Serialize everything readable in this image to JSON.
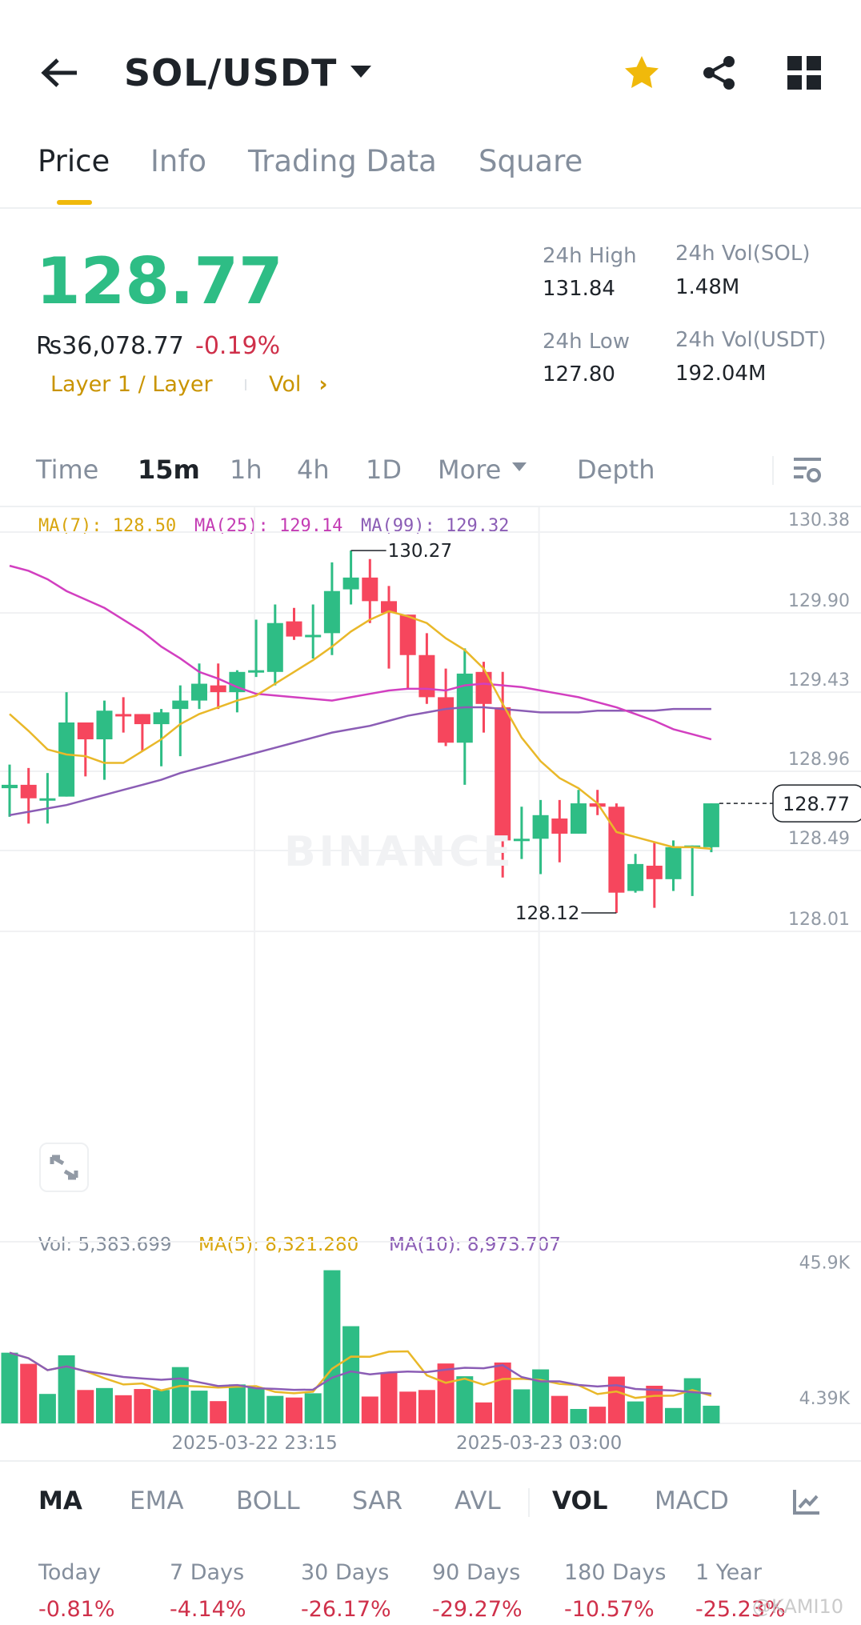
{
  "header": {
    "title": "SOL/USDT",
    "icons": [
      "back-arrow-icon",
      "caret-down-icon",
      "star-icon",
      "share-icon",
      "grid-icon"
    ]
  },
  "tabs": [
    {
      "label": "Price"
    },
    {
      "label": "Info"
    },
    {
      "label": "Trading Data"
    },
    {
      "label": "Square"
    }
  ],
  "ticker": {
    "last_price": "128.77",
    "fiat_price": "₨36,078.77",
    "change": "-0.19%",
    "tag": "Layer 1 / Layer",
    "vol_link": "Vol",
    "stats": {
      "high_label": "24h High",
      "high": "131.84",
      "low_label": "24h Low",
      "low": "127.80",
      "vol_sol_label": "24h Vol(SOL)",
      "vol_sol": "1.48M",
      "vol_usdt_label": "24h Vol(USDT)",
      "vol_usdt": "192.04M"
    }
  },
  "intervals": [
    {
      "label": "Time"
    },
    {
      "label": "15m"
    },
    {
      "label": "1h"
    },
    {
      "label": "4h"
    },
    {
      "label": "1D"
    },
    {
      "label": "More"
    },
    {
      "label": "Depth"
    }
  ],
  "legend": {
    "ma7": "MA(7): 128.50",
    "ma25": "MA(25): 129.14",
    "ma99": "MA(99): 129.32",
    "vol": "Vol: 5,383.699",
    "vma5": "MA(5): 8,321.280",
    "vma10": "MA(10): 8,973.707"
  },
  "colors": {
    "up": "#2EBD85",
    "down": "#F6465D",
    "ma7": "#E9B829",
    "ma25": "#D23FC0",
    "ma99": "#8B5DB5",
    "accent": "#F0B90B"
  },
  "chart_data": {
    "type": "candlestick",
    "interval": "15m",
    "price_ticks": [
      "130.38",
      "129.90",
      "129.43",
      "128.96",
      "128.49",
      "128.01"
    ],
    "price_range": [
      128.01,
      130.38
    ],
    "last_price_tag": "128.77",
    "high_marker": "130.27",
    "low_marker": "128.12",
    "x_ticks": [
      "2025-03-22 23:15",
      "2025-03-23 03:00"
    ],
    "x_tick_index": [
      13,
      28
    ],
    "ohlc": [
      [
        128.86,
        129.0,
        128.69,
        128.88
      ],
      [
        128.88,
        128.98,
        128.65,
        128.8
      ],
      [
        128.79,
        128.95,
        128.65,
        128.8
      ],
      [
        128.81,
        129.43,
        128.81,
        129.25
      ],
      [
        129.25,
        129.25,
        128.93,
        129.15
      ],
      [
        129.15,
        129.38,
        128.91,
        129.32
      ],
      [
        129.3,
        129.4,
        129.19,
        129.29
      ],
      [
        129.3,
        129.3,
        129.08,
        129.24
      ],
      [
        129.24,
        129.33,
        128.99,
        129.31
      ],
      [
        129.33,
        129.47,
        129.05,
        129.38
      ],
      [
        129.38,
        129.6,
        129.33,
        129.48
      ],
      [
        129.47,
        129.6,
        129.33,
        129.43
      ],
      [
        129.43,
        129.56,
        129.31,
        129.55
      ],
      [
        129.55,
        129.86,
        129.52,
        129.56
      ],
      [
        129.55,
        129.95,
        129.47,
        129.84
      ],
      [
        129.85,
        129.93,
        129.74,
        129.76
      ],
      [
        129.76,
        129.95,
        129.63,
        129.77
      ],
      [
        129.78,
        130.2,
        129.65,
        130.03
      ],
      [
        130.04,
        130.27,
        129.95,
        130.11
      ],
      [
        130.11,
        130.22,
        129.84,
        129.97
      ],
      [
        129.97,
        130.06,
        129.57,
        129.9
      ],
      [
        129.89,
        129.89,
        129.45,
        129.65
      ],
      [
        129.65,
        129.78,
        129.36,
        129.4
      ],
      [
        129.4,
        129.57,
        129.11,
        129.13
      ],
      [
        129.13,
        129.69,
        128.88,
        129.54
      ],
      [
        129.55,
        129.61,
        129.19,
        129.36
      ],
      [
        129.34,
        129.55,
        128.33,
        128.55
      ],
      [
        128.55,
        128.75,
        128.44,
        128.56
      ],
      [
        128.56,
        128.79,
        128.35,
        128.7
      ],
      [
        128.68,
        128.79,
        128.42,
        128.59
      ],
      [
        128.59,
        128.85,
        128.59,
        128.77
      ],
      [
        128.77,
        128.85,
        128.7,
        128.75
      ],
      [
        128.75,
        128.77,
        128.12,
        128.24
      ],
      [
        128.25,
        128.47,
        128.24,
        128.41
      ],
      [
        128.4,
        128.54,
        128.15,
        128.32
      ],
      [
        128.32,
        128.55,
        128.25,
        128.51
      ],
      [
        128.51,
        128.52,
        128.22,
        128.52
      ],
      [
        128.51,
        128.77,
        128.48,
        128.77
      ]
    ],
    "ma7": [
      129.3,
      129.2,
      129.09,
      129.06,
      129.05,
      129.01,
      129.01,
      129.08,
      129.15,
      129.24,
      129.3,
      129.34,
      129.38,
      129.41,
      129.48,
      129.55,
      129.62,
      129.7,
      129.79,
      129.86,
      129.91,
      129.88,
      129.84,
      129.75,
      129.68,
      129.57,
      129.36,
      129.16,
      129.02,
      128.92,
      128.86,
      128.77,
      128.6,
      128.57,
      128.54,
      128.51,
      128.51,
      128.5
    ],
    "ma25": [
      130.18,
      130.15,
      130.1,
      130.03,
      129.98,
      129.93,
      129.86,
      129.79,
      129.7,
      129.63,
      129.55,
      129.51,
      129.46,
      129.42,
      129.41,
      129.4,
      129.39,
      129.38,
      129.4,
      129.42,
      129.44,
      129.45,
      129.45,
      129.44,
      129.47,
      129.48,
      129.47,
      129.46,
      129.44,
      129.42,
      129.4,
      129.37,
      129.34,
      129.3,
      129.26,
      129.21,
      129.18,
      129.15
    ],
    "ma99": [
      128.7,
      128.72,
      128.74,
      128.76,
      128.79,
      128.82,
      128.85,
      128.88,
      128.91,
      128.95,
      128.98,
      129.01,
      129.04,
      129.07,
      129.1,
      129.13,
      129.16,
      129.19,
      129.21,
      129.23,
      129.26,
      129.29,
      129.31,
      129.33,
      129.34,
      129.34,
      129.33,
      129.32,
      129.31,
      129.31,
      129.31,
      129.32,
      129.32,
      129.32,
      129.32,
      129.33,
      129.33,
      129.33
    ],
    "volume_k": [
      21.6,
      18.2,
      9.0,
      20.8,
      10.2,
      10.8,
      8.6,
      10.5,
      10.2,
      17.2,
      10.0,
      6.8,
      11.9,
      11.0,
      8.4,
      7.9,
      9.2,
      46.8,
      29.7,
      8.2,
      15.6,
      9.7,
      10.2,
      18.3,
      14.4,
      6.4,
      18.6,
      10.4,
      16.5,
      8.4,
      4.4,
      5.1,
      14.3,
      6.7,
      11.5,
      4.7,
      13.8,
      5.4
    ],
    "volume_ticks": [
      "45.9K",
      "4.39K"
    ],
    "volume_tick_values": [
      45.9,
      4.39
    ]
  },
  "indicators": [
    {
      "label": "MA"
    },
    {
      "label": "EMA"
    },
    {
      "label": "BOLL"
    },
    {
      "label": "SAR"
    },
    {
      "label": "AVL"
    },
    {
      "label": "VOL"
    },
    {
      "label": "MACD"
    }
  ],
  "performance": [
    {
      "label": "Today",
      "value": "-0.81%"
    },
    {
      "label": "7 Days",
      "value": "-4.14%"
    },
    {
      "label": "30 Days",
      "value": "-26.17%"
    },
    {
      "label": "90 Days",
      "value": "-29.27%"
    },
    {
      "label": "180 Days",
      "value": "-10.57%"
    },
    {
      "label": "1 Year",
      "value": "-25.23%"
    }
  ],
  "watermark": "BINANCE",
  "credit": "@KAMI10"
}
